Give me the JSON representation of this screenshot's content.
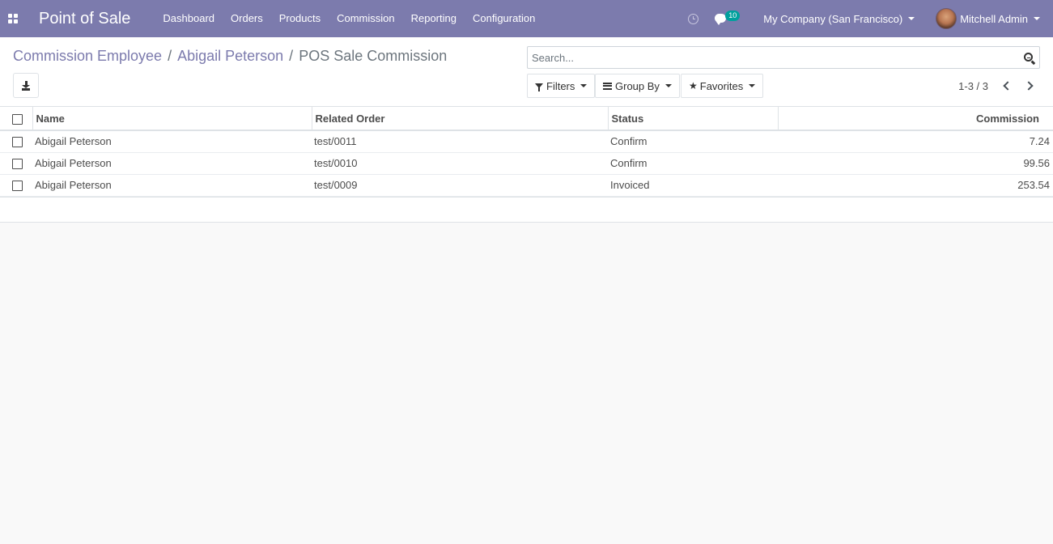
{
  "navbar": {
    "brand": "Point of Sale",
    "menu": [
      "Dashboard",
      "Orders",
      "Products",
      "Commission",
      "Reporting",
      "Configuration"
    ],
    "chat_count": "10",
    "company": "My Company (San Francisco)",
    "user": "Mitchell Admin"
  },
  "breadcrumb": {
    "items": [
      "Commission Employee",
      "Abigail Peterson"
    ],
    "current": "POS Sale Commission",
    "separator": "/"
  },
  "search": {
    "placeholder": "Search..."
  },
  "facets": {
    "filters": "Filters",
    "group_by": "Group By",
    "favorites": "Favorites"
  },
  "pager": {
    "value": "1-3 / 3"
  },
  "table": {
    "columns": [
      "Name",
      "Related Order",
      "Status",
      "Commission"
    ],
    "rows": [
      {
        "name": "Abigail Peterson",
        "order": "test/0011",
        "status": "Confirm",
        "commission": "7.24"
      },
      {
        "name": "Abigail Peterson",
        "order": "test/0010",
        "status": "Confirm",
        "commission": "99.56"
      },
      {
        "name": "Abigail Peterson",
        "order": "test/0009",
        "status": "Invoiced",
        "commission": "253.54"
      }
    ]
  },
  "colors": {
    "brand": "#7c7bad",
    "badge": "#00a09d"
  }
}
